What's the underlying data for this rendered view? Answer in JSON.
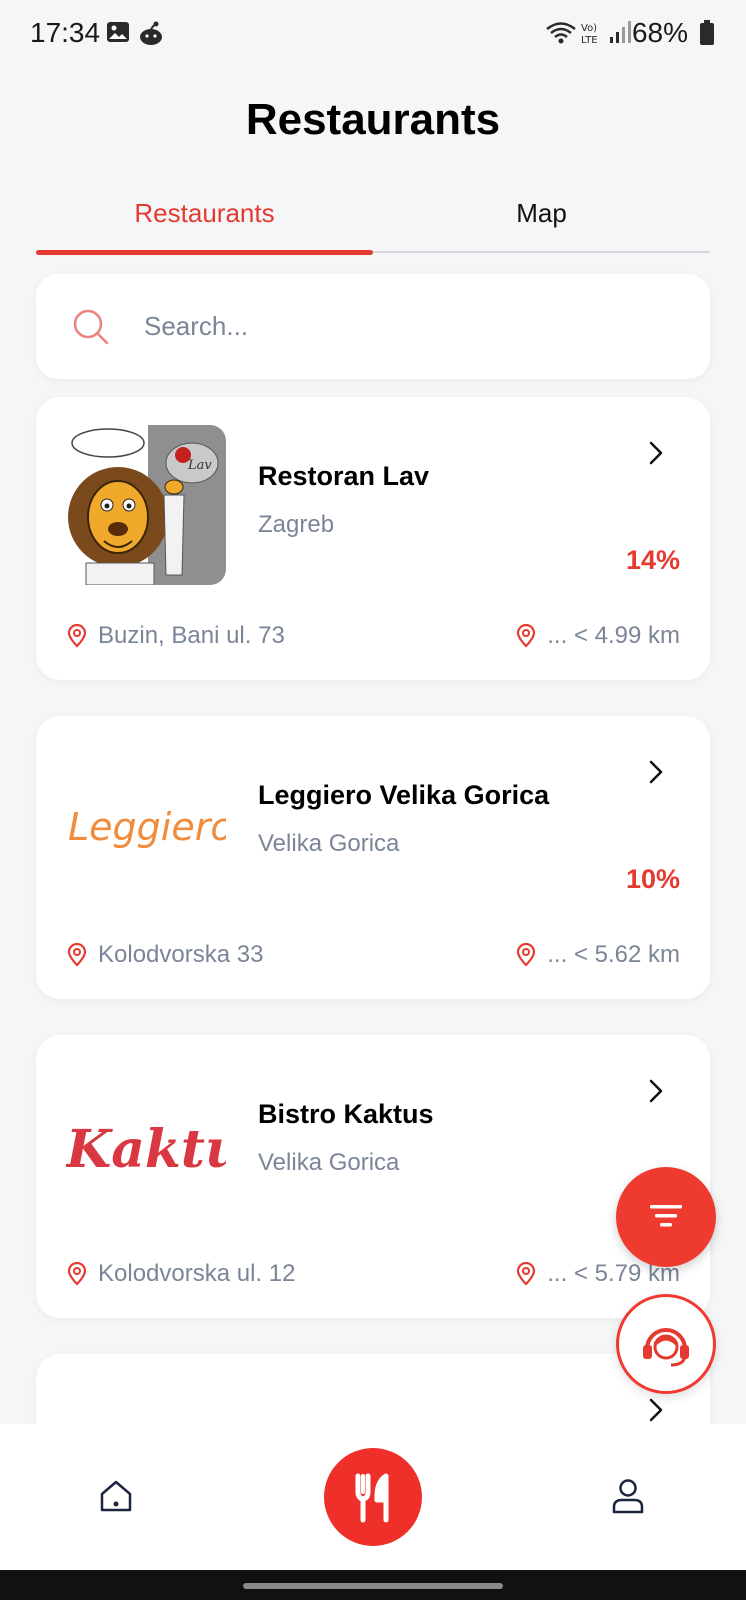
{
  "status_bar": {
    "time": "17:34",
    "battery": "68%",
    "icons": [
      "gallery-icon",
      "app-notification-icon",
      "wifi-icon",
      "volte-icon",
      "signal-icon",
      "battery-icon"
    ]
  },
  "header": {
    "title": "Restaurants"
  },
  "tabs": [
    {
      "label": "Restaurants",
      "active": true
    },
    {
      "label": "Map",
      "active": false
    }
  ],
  "search": {
    "placeholder": "Search...",
    "value": ""
  },
  "restaurants": [
    {
      "name": "Restoran Lav",
      "city": "Zagreb",
      "discount": "14%",
      "address": "Buzin, Bani ul. 73",
      "distance": "... < 4.99 km",
      "logo": "lion-chef-logo"
    },
    {
      "name": "Leggiero Velika Gorica",
      "city": "Velika Gorica",
      "discount": "10%",
      "address": "Kolodvorska 33",
      "distance": "... < 5.62 km",
      "logo_text": "Leggiero"
    },
    {
      "name": "Bistro Kaktus",
      "city": "Velika Gorica",
      "discount": "",
      "address": "Kolodvorska ul. 12",
      "distance": "... < 5.79 km",
      "logo_text": "Kaktus"
    }
  ],
  "floating_buttons": {
    "filter": "filter-icon",
    "support": "support-agent-icon"
  },
  "bottom_nav": {
    "items": [
      "home-icon",
      "restaurants-icon",
      "profile-icon"
    ],
    "active": "restaurants-icon"
  },
  "colors": {
    "accent": "#e53a2f",
    "muted_text": "#7b8598",
    "background": "#f5f6f8"
  }
}
